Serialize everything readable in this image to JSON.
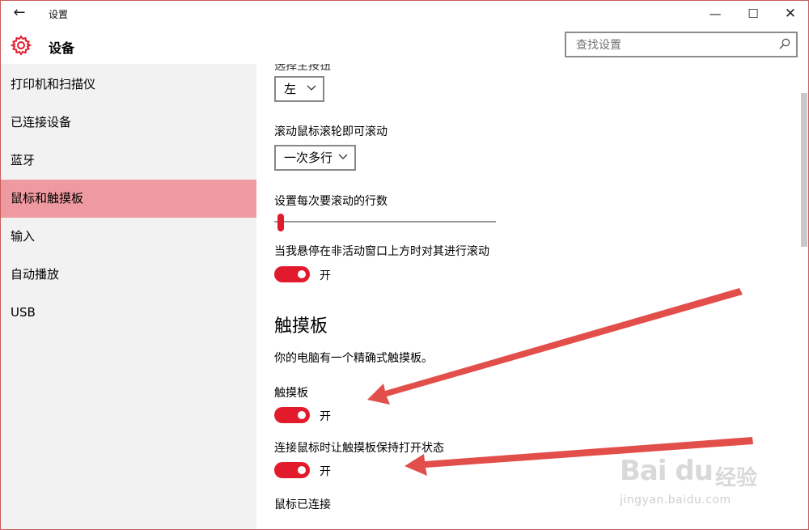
{
  "window": {
    "title": "设置",
    "back_glyph": "←",
    "minimize_glyph": "—",
    "maximize_glyph": "☐",
    "close_glyph": "✕"
  },
  "header": {
    "title": "设备",
    "search_placeholder": "查找设置",
    "accent_color": "#e21b2c"
  },
  "sidebar": {
    "items": [
      {
        "label": "打印机和扫描仪"
      },
      {
        "label": "已连接设备"
      },
      {
        "label": "蓝牙"
      },
      {
        "label": "鼠标和触摸板",
        "active": true
      },
      {
        "label": "输入"
      },
      {
        "label": "自动播放"
      },
      {
        "label": "USB"
      }
    ]
  },
  "content": {
    "primary_button_label": "选择主按钮",
    "primary_button_value": "左",
    "scroll_wheel_label": "滚动鼠标滚轮即可滚动",
    "scroll_wheel_value": "一次多行",
    "lines_to_scroll_label": "设置每次要滚动的行数",
    "lines_to_scroll_level_percent": 3,
    "inactive_scroll_label": "当我悬停在非活动窗口上方时对其进行滚动",
    "inactive_scroll_state": "开",
    "touchpad_heading": "触摸板",
    "touchpad_description": "你的电脑有一个精确式触摸板。",
    "touchpad_label": "触摸板",
    "touchpad_state": "开",
    "keep_touchpad_label": "连接鼠标时让触摸板保持打开状态",
    "keep_touchpad_state": "开",
    "mouse_connected_label": "鼠标已连接"
  },
  "watermark": {
    "brand": "Bai du",
    "cn": "经验",
    "url": "jingyan.baidu.com"
  }
}
